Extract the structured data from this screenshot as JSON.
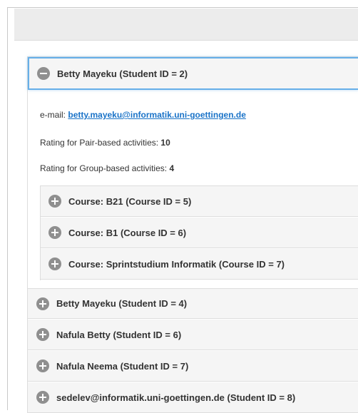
{
  "student_open": {
    "title": "Betty Mayeku (Student ID = 2)",
    "email_label": "e-mail:",
    "email": "betty.mayeku@informatik.uni-goettingen.de",
    "pair_label": "Rating for Pair-based activities:",
    "pair_value": "10",
    "group_label": "Rating for Group-based activities:",
    "group_value": "4",
    "courses": [
      {
        "title": "Course: B21 (Course ID = 5)"
      },
      {
        "title": "Course: B1 (Course ID = 6)"
      },
      {
        "title": "Course: Sprintstudium Informatik (Course ID = 7)"
      }
    ]
  },
  "students": [
    {
      "title": "Betty Mayeku (Student ID = 4)"
    },
    {
      "title": "Nafula Betty (Student ID = 6)"
    },
    {
      "title": "Nafula Neema (Student ID = 7)"
    },
    {
      "title": "sedelev@informatik.uni-goettingen.de (Student ID = 8)"
    }
  ],
  "icons": {
    "expanded": "minus-circle-icon",
    "collapsed": "plus-circle-icon"
  }
}
